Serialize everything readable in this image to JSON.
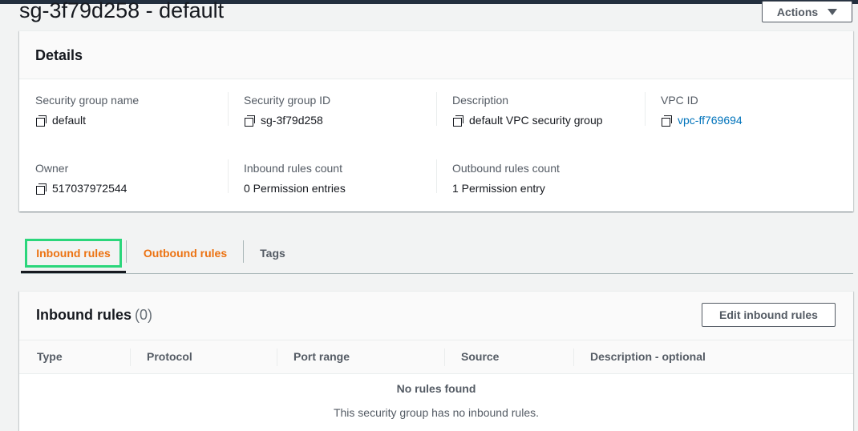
{
  "page": {
    "title": "sg-3f79d258 - default",
    "actions_label": "Actions"
  },
  "details": {
    "heading": "Details",
    "fields": [
      {
        "label": "Security group name",
        "value": "default",
        "copyable": true
      },
      {
        "label": "Security group ID",
        "value": "sg-3f79d258",
        "copyable": true
      },
      {
        "label": "Description",
        "value": "default VPC security group",
        "copyable": true
      },
      {
        "label": "VPC ID",
        "value": "vpc-ff769694",
        "copyable": true,
        "link": true
      },
      {
        "label": "Owner",
        "value": "517037972544",
        "copyable": true
      },
      {
        "label": "Inbound rules count",
        "value": "0 Permission entries"
      },
      {
        "label": "Outbound rules count",
        "value": "1 Permission entry"
      }
    ]
  },
  "tabs": [
    {
      "label": "Inbound rules",
      "active": true
    },
    {
      "label": "Outbound rules"
    },
    {
      "label": "Tags"
    }
  ],
  "inbound": {
    "title": "Inbound rules",
    "count": "(0)",
    "edit_label": "Edit inbound rules",
    "columns": [
      "Type",
      "Protocol",
      "Port range",
      "Source",
      "Description - optional"
    ],
    "empty_title": "No rules found",
    "empty_message": "This security group has no inbound rules."
  },
  "colors": {
    "accent_orange": "#ec7211",
    "link_blue": "#0073bb",
    "highlight_green": "#2bd67b"
  }
}
